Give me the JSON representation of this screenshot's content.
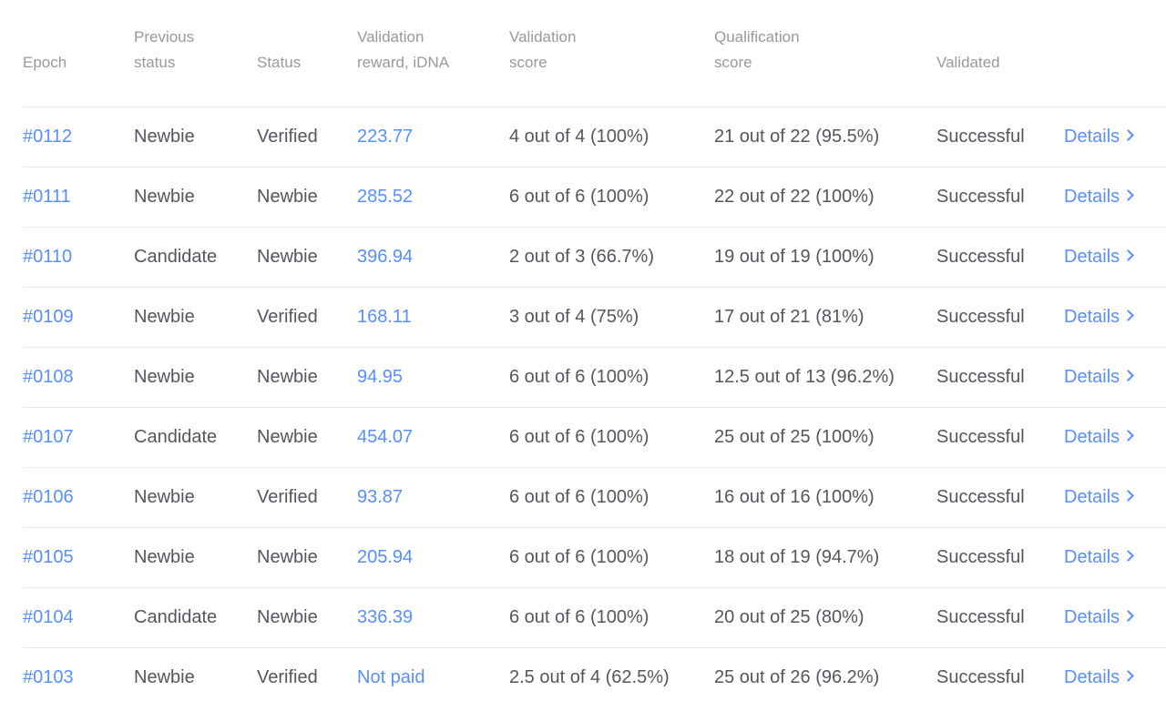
{
  "headers": {
    "epoch": "Epoch",
    "previous_status": "Previous status",
    "status": "Status",
    "validation_reward": "Validation reward, iDNA",
    "validation_score": "Validation score",
    "qualification_score": "Qualification score",
    "validated": "Validated"
  },
  "rows": [
    {
      "epoch": "#0112",
      "previous_status": "Newbie",
      "status": "Verified",
      "reward": "223.77",
      "validation_score": "4 out of 4 (100%)",
      "qualification_score": "21 out of 22 (95.5%)",
      "validated": "Successful",
      "details": "Details"
    },
    {
      "epoch": "#0111",
      "previous_status": "Newbie",
      "status": "Newbie",
      "reward": "285.52",
      "validation_score": "6 out of 6 (100%)",
      "qualification_score": "22 out of 22 (100%)",
      "validated": "Successful",
      "details": "Details"
    },
    {
      "epoch": "#0110",
      "previous_status": "Candidate",
      "status": "Newbie",
      "reward": "396.94",
      "validation_score": "2 out of 3 (66.7%)",
      "qualification_score": "19 out of 19 (100%)",
      "validated": "Successful",
      "details": "Details"
    },
    {
      "epoch": "#0109",
      "previous_status": "Newbie",
      "status": "Verified",
      "reward": "168.11",
      "validation_score": "3 out of 4 (75%)",
      "qualification_score": "17 out of 21 (81%)",
      "validated": "Successful",
      "details": "Details"
    },
    {
      "epoch": "#0108",
      "previous_status": "Newbie",
      "status": "Newbie",
      "reward": "94.95",
      "validation_score": "6 out of 6 (100%)",
      "qualification_score": "12.5 out of 13 (96.2%)",
      "validated": "Successful",
      "details": "Details"
    },
    {
      "epoch": "#0107",
      "previous_status": "Candidate",
      "status": "Newbie",
      "reward": "454.07",
      "validation_score": "6 out of 6 (100%)",
      "qualification_score": "25 out of 25 (100%)",
      "validated": "Successful",
      "details": "Details"
    },
    {
      "epoch": "#0106",
      "previous_status": "Newbie",
      "status": "Verified",
      "reward": "93.87",
      "validation_score": "6 out of 6 (100%)",
      "qualification_score": "16 out of 16 (100%)",
      "validated": "Successful",
      "details": "Details"
    },
    {
      "epoch": "#0105",
      "previous_status": "Newbie",
      "status": "Newbie",
      "reward": "205.94",
      "validation_score": "6 out of 6 (100%)",
      "qualification_score": "18 out of 19 (94.7%)",
      "validated": "Successful",
      "details": "Details"
    },
    {
      "epoch": "#0104",
      "previous_status": "Candidate",
      "status": "Newbie",
      "reward": "336.39",
      "validation_score": "6 out of 6 (100%)",
      "qualification_score": "20 out of 25 (80%)",
      "validated": "Successful",
      "details": "Details"
    },
    {
      "epoch": "#0103",
      "previous_status": "Newbie",
      "status": "Verified",
      "reward": "Not paid",
      "validation_score": "2.5 out of 4 (62.5%)",
      "qualification_score": "25 out of 26 (96.2%)",
      "validated": "Successful",
      "details": "Details"
    }
  ],
  "colors": {
    "link": "#578fff",
    "text": "#53565c",
    "header_text": "#96999e",
    "divider": "#e8eaed"
  },
  "icons": {
    "details": "chevron-right-icon"
  }
}
